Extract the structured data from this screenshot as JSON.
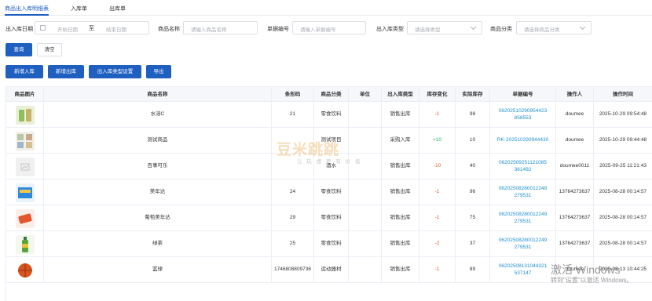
{
  "tabs": [
    {
      "label": "商品出入库明细表",
      "active": true
    },
    {
      "label": "入库单",
      "active": false
    },
    {
      "label": "出库单",
      "active": false
    }
  ],
  "filters": {
    "date_label": "出入库日期",
    "date_start_placeholder": "开始日期",
    "date_separator": "至",
    "date_end_placeholder": "结束日期",
    "product_name_label": "商品名称",
    "product_name_placeholder": "请输入商品名称",
    "document_no_label": "单据编号",
    "document_no_placeholder": "请输入单据编号",
    "io_type_label": "出入库类型",
    "io_type_placeholder": "请选择类型",
    "category_label": "商品分类",
    "category_placeholder": "请选择商品分类"
  },
  "actions": {
    "search": "查询",
    "clear": "清空",
    "new_inbound": "新增入库",
    "new_outbound": "新增出库",
    "io_type_settings": "出入库类型设置",
    "export": "导出"
  },
  "table": {
    "columns": [
      "商品图片",
      "商品名称",
      "条形码",
      "商品分类",
      "单位",
      "出入库类型",
      "库存变化",
      "实际库存",
      "单据编号",
      "操作人",
      "操作时间"
    ],
    "rows": [
      {
        "image": "product-image-water",
        "name": "水溶C",
        "barcode": "21",
        "category": "零食饮料",
        "unit": "",
        "io_type": "销售出库",
        "change": "-1",
        "change_sign": "neg",
        "stock": "98",
        "doc_no": "06202510290954423 858553",
        "operator": "doumee",
        "time": "2025-10-29 09:54:48"
      },
      {
        "image": "product-image-mix",
        "name": "测试商品",
        "barcode": "",
        "category": "测试项目",
        "unit": "",
        "io_type": "采购入库",
        "change": "+10",
        "change_sign": "pos",
        "stock": "10",
        "doc_no": "RK-202510290944430",
        "operator": "doumee",
        "time": "2025-10-29 09:44:48"
      },
      {
        "image": "product-image-placeholder",
        "name": "百事可乐",
        "barcode": "",
        "category": "酒水",
        "unit": "",
        "io_type": "销售出库",
        "change": "-10",
        "change_sign": "neg",
        "stock": "40",
        "doc_no": "06202509251121085 361492",
        "operator": "doumee0011",
        "time": "2025-09-25 11:21:43"
      },
      {
        "image": "product-image-box",
        "name": "美年达",
        "barcode": "24",
        "category": "零食饮料",
        "unit": "",
        "io_type": "销售出库",
        "change": "-1",
        "change_sign": "neg",
        "stock": "96",
        "doc_no": "06202508280012249 279531",
        "operator": "13764273637",
        "time": "2025-08-28 00:14:57"
      },
      {
        "image": "product-image-can",
        "name": "葡萄美年达",
        "barcode": "29",
        "category": "零食饮料",
        "unit": "",
        "io_type": "销售出库",
        "change": "-1",
        "change_sign": "neg",
        "stock": "75",
        "doc_no": "06202508280012249 279531",
        "operator": "13764273637",
        "time": "2025-08-28 00:14:57"
      },
      {
        "image": "product-image-bottle",
        "name": "绿茶",
        "barcode": "25",
        "category": "零食饮料",
        "unit": "",
        "io_type": "销售出库",
        "change": "-2",
        "change_sign": "neg",
        "stock": "37",
        "doc_no": "06202508280012249 279531",
        "operator": "13764273637",
        "time": "2025-08-28 00:14:57"
      },
      {
        "image": "product-image-ball",
        "name": "篮球",
        "barcode": "1746808809736",
        "category": "运动器材",
        "unit": "",
        "io_type": "销售出库",
        "change": "-1",
        "change_sign": "neg",
        "stock": "89",
        "doc_no": "06202508131044321 537147",
        "operator": "doumee",
        "time": "2025-08-13 10:44:25"
      }
    ]
  },
  "watermark": {
    "brand": "豆米跳跳",
    "slogan": "让 玩 摆 更 有 价 值"
  },
  "os_activation": {
    "title": "激活 Windows",
    "subtitle": "转到\"设置\"以激活 Windows。"
  },
  "colors": {
    "primary": "#1e5fbf",
    "link": "#1f8fcf",
    "positive": "#26a65b",
    "negative": "#e4572e",
    "header_bg": "#f5f7fa"
  }
}
